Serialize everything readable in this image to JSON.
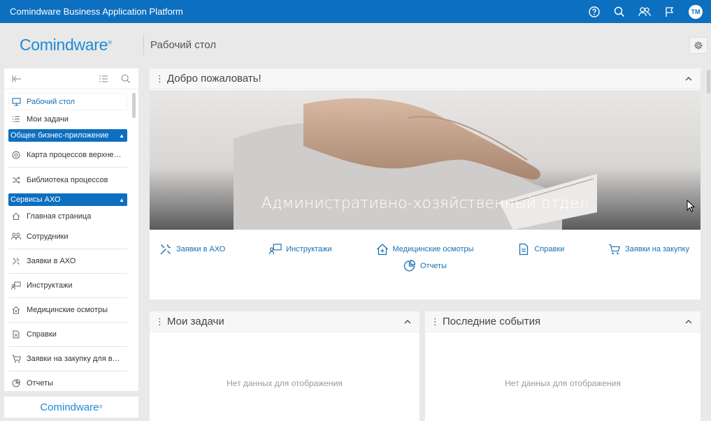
{
  "topbar": {
    "app_title": "Comindware Business Application Platform",
    "avatar_initials": "TM",
    "icons": [
      "help-icon",
      "search-icon",
      "users-icon",
      "flag-icon"
    ]
  },
  "header": {
    "logo_text": "Comindware",
    "page_title": "Рабочий стол"
  },
  "sidebar": {
    "items": [
      {
        "label": "Рабочий стол",
        "icon": "desktop-icon"
      },
      {
        "label": "Мои задачи",
        "icon": "tasks-list-icon"
      },
      {
        "group": "Общее бизнес-приложение"
      },
      {
        "label": "Карта процессов верхне…",
        "icon": "target-icon"
      },
      {
        "label": "Библиотека процессов",
        "icon": "shuffle-icon"
      },
      {
        "group": "Сервисы АХО"
      },
      {
        "label": "Главная страница",
        "icon": "home-icon"
      },
      {
        "label": "Сотрудники",
        "icon": "people-icon"
      },
      {
        "label": "Заявки в АХО",
        "icon": "tools-icon"
      },
      {
        "label": "Инструктажи",
        "icon": "instructor-icon"
      },
      {
        "label": "Медицинские осмотры",
        "icon": "medical-icon"
      },
      {
        "label": "Справки",
        "icon": "document-icon"
      },
      {
        "label": "Заявки на закупку для в…",
        "icon": "cart-icon"
      },
      {
        "label": "Отчеты",
        "icon": "chart-icon"
      }
    ],
    "footer_logo": "Comindware"
  },
  "welcome": {
    "title": "Добро пожаловать!",
    "hero_caption": "Административно-хозяйственный отдел",
    "links": [
      {
        "label": "Заявки в АХО",
        "icon": "tools-icon"
      },
      {
        "label": "Инструктажи",
        "icon": "instructor-icon"
      },
      {
        "label": "Медицинские осмотры",
        "icon": "medical-icon"
      },
      {
        "label": "Справки",
        "icon": "document-icon"
      },
      {
        "label": "Заявки на закупку",
        "icon": "cart-icon"
      },
      {
        "label": "Отчеты",
        "icon": "chart-icon"
      }
    ]
  },
  "tasks": {
    "title": "Мои задачи",
    "empty": "Нет данных для отображения"
  },
  "events": {
    "title": "Последние события",
    "empty": "Нет данных для отображения"
  },
  "colors": {
    "brand": "#0d6fbf",
    "link": "#1a6fb0",
    "background": "#e9e9e9"
  }
}
